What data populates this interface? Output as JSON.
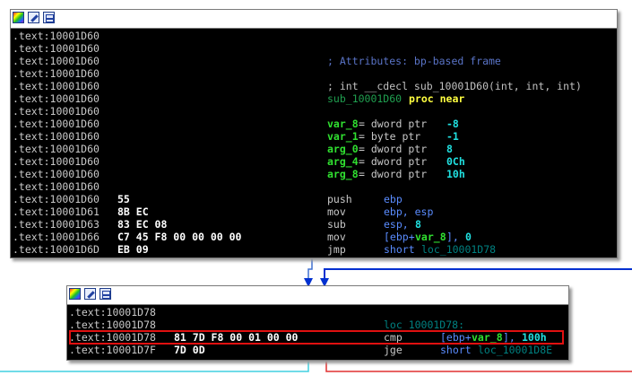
{
  "node1": {
    "lines": [
      {
        "addr": ".text:10001D60"
      },
      {
        "addr": ".text:10001D60"
      },
      {
        "addr": ".text:10001D60",
        "comment": "; Attributes: bp-based frame"
      },
      {
        "addr": ".text:10001D60"
      },
      {
        "addr": ".text:10001D60",
        "prototype": "; int __cdecl sub_10001D60(int, int, int)"
      },
      {
        "addr": ".text:10001D60",
        "procname": "sub_10001D60",
        "proc": "proc near"
      },
      {
        "addr": ".text:10001D60"
      },
      {
        "addr": ".text:10001D60",
        "var": "var_8",
        "def": "= dword ptr",
        "val": "-8"
      },
      {
        "addr": ".text:10001D60",
        "var": "var_1",
        "def": "= byte ptr",
        "val": "-1"
      },
      {
        "addr": ".text:10001D60",
        "var": "arg_0",
        "def": "= dword ptr",
        "val": "8"
      },
      {
        "addr": ".text:10001D60",
        "var": "arg_4",
        "def": "= dword ptr",
        "val": "0Ch"
      },
      {
        "addr": ".text:10001D60",
        "var": "arg_8",
        "def": "= dword ptr",
        "val": "10h"
      },
      {
        "addr": ".text:10001D60"
      },
      {
        "addr": ".text:10001D60",
        "bytes": "55",
        "mnemonic": "push",
        "operand": "ebp"
      },
      {
        "addr": ".text:10001D61",
        "bytes": "8B EC",
        "mnemonic": "mov",
        "operand": "ebp, esp"
      },
      {
        "addr": ".text:10001D63",
        "bytes": "83 EC 08",
        "mnemonic": "sub",
        "operand": "esp, ",
        "imm": "8"
      },
      {
        "addr": ".text:10001D66",
        "bytes": "C7 45 F8 00 00 00 00",
        "mnemonic": "mov",
        "operand": "[ebp+",
        "operand_var": "var_8",
        "operand_tail": "], ",
        "imm": "0"
      },
      {
        "addr": ".text:10001D6D",
        "bytes": "EB 09",
        "mnemonic": "jmp",
        "operand": "short ",
        "target": "loc_10001D78"
      }
    ]
  },
  "node2": {
    "lines": [
      {
        "addr": ".text:10001D78"
      },
      {
        "addr": ".text:10001D78",
        "label": "loc_10001D78:"
      },
      {
        "addr": ".text:10001D78",
        "bytes": "81 7D F8 00 01 00 00",
        "mnemonic": "cmp",
        "operand": "[ebp+",
        "operand_var": "var_8",
        "operand_tail": "], ",
        "imm": "100h"
      },
      {
        "addr": ".text:10001D7F",
        "bytes": "7D 0D",
        "mnemonic": "jge",
        "operand": "short ",
        "target": "loc_10001D8E"
      }
    ]
  },
  "colors": {
    "highlight": "#e01010",
    "edge_blue": "#0030d0",
    "edge_cyan": "#40d0e0",
    "edge_red": "#e03030"
  }
}
